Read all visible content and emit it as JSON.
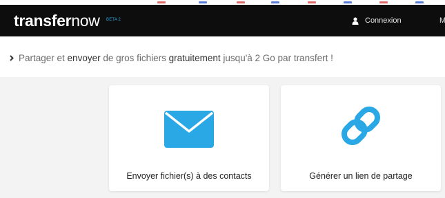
{
  "colors": {
    "navbar_bg": "#0d0d0d",
    "accent": "#2aa8e6",
    "content_bg": "#f3f3f3",
    "card_bg": "#ffffff"
  },
  "header": {
    "logo_bold": "transfer",
    "logo_light": "now",
    "beta": "BETA 2",
    "login_label": "Connexion",
    "cut_menu_label": "M"
  },
  "tagline": {
    "part1": "Partager et ",
    "part2": "envoyer",
    "part3": " de gros fichiers ",
    "part4": "gratuitement",
    "part5": " jusqu'à 2 Go par transfert !"
  },
  "cards": [
    {
      "label": "Envoyer fichier(s) à des contacts",
      "icon": "envelope-icon"
    },
    {
      "label": "Générer un lien de partage",
      "icon": "link-icon"
    }
  ]
}
